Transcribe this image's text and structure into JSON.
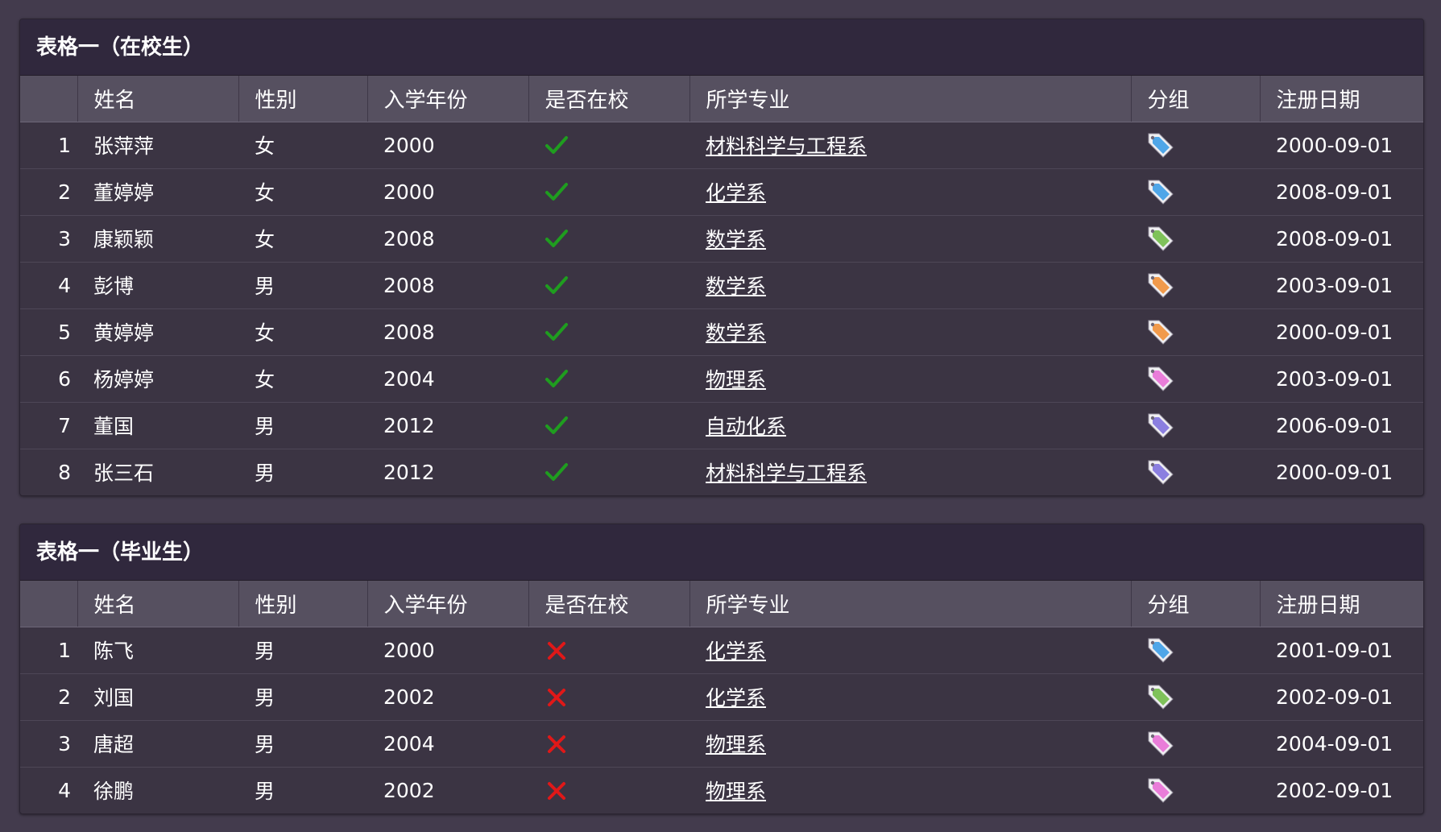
{
  "columns": [
    "",
    "姓名",
    "性别",
    "入学年份",
    "是否在校",
    "所学专业",
    "分组",
    "注册日期"
  ],
  "status_colors": {
    "check": "#1f9d1f",
    "cross": "#e01818"
  },
  "tag_colors": {
    "blue": "#4fa6e8",
    "green": "#7fc25a",
    "orange": "#f19a4b",
    "pink": "#e97dd9",
    "purple": "#8b7fe0"
  },
  "tables": [
    {
      "title": "表格一（在校生）",
      "rows": [
        {
          "idx": "1",
          "name": "张萍萍",
          "sex": "女",
          "year": "2000",
          "status": "check-icon",
          "major": "材料科学与工程系",
          "tag": "blue",
          "date": "2000-09-01"
        },
        {
          "idx": "2",
          "name": "董婷婷",
          "sex": "女",
          "year": "2000",
          "status": "check-icon",
          "major": "化学系",
          "tag": "blue",
          "date": "2008-09-01"
        },
        {
          "idx": "3",
          "name": "康颖颖",
          "sex": "女",
          "year": "2008",
          "status": "check-icon",
          "major": "数学系",
          "tag": "green",
          "date": "2008-09-01"
        },
        {
          "idx": "4",
          "name": "彭博",
          "sex": "男",
          "year": "2008",
          "status": "check-icon",
          "major": "数学系",
          "tag": "orange",
          "date": "2003-09-01"
        },
        {
          "idx": "5",
          "name": "黄婷婷",
          "sex": "女",
          "year": "2008",
          "status": "check-icon",
          "major": "数学系",
          "tag": "orange",
          "date": "2000-09-01"
        },
        {
          "idx": "6",
          "name": "杨婷婷",
          "sex": "女",
          "year": "2004",
          "status": "check-icon",
          "major": "物理系",
          "tag": "pink",
          "date": "2003-09-01"
        },
        {
          "idx": "7",
          "name": "董国",
          "sex": "男",
          "year": "2012",
          "status": "check-icon",
          "major": "自动化系",
          "tag": "purple",
          "date": "2006-09-01"
        },
        {
          "idx": "8",
          "name": "张三石",
          "sex": "男",
          "year": "2012",
          "status": "check-icon",
          "major": "材料科学与工程系",
          "tag": "purple",
          "date": "2000-09-01"
        }
      ]
    },
    {
      "title": "表格一（毕业生）",
      "rows": [
        {
          "idx": "1",
          "name": "陈飞",
          "sex": "男",
          "year": "2000",
          "status": "cross-icon",
          "major": "化学系",
          "tag": "blue",
          "date": "2001-09-01"
        },
        {
          "idx": "2",
          "name": "刘国",
          "sex": "男",
          "year": "2002",
          "status": "cross-icon",
          "major": "化学系",
          "tag": "green",
          "date": "2002-09-01"
        },
        {
          "idx": "3",
          "name": "唐超",
          "sex": "男",
          "year": "2004",
          "status": "cross-icon",
          "major": "物理系",
          "tag": "pink",
          "date": "2004-09-01"
        },
        {
          "idx": "4",
          "name": "徐鹏",
          "sex": "男",
          "year": "2002",
          "status": "cross-icon",
          "major": "物理系",
          "tag": "pink",
          "date": "2002-09-01"
        }
      ]
    }
  ]
}
